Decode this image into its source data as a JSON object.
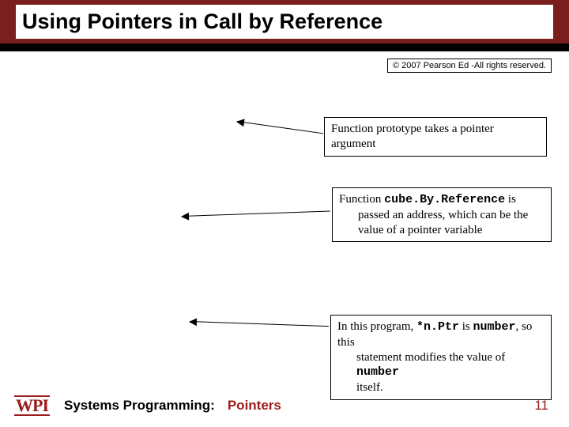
{
  "title": "Using Pointers in Call by Reference",
  "copyright": "© 2007 Pearson Ed -All rights reserved.",
  "callouts": {
    "c1": {
      "text": "Function prototype takes a pointer argument"
    },
    "c2": {
      "line1_pre": "Function ",
      "line1_code": "cube.By.Reference",
      "line1_post": " is",
      "line2": "passed an address, which can be the",
      "line3": "value of a pointer variable"
    },
    "c3": {
      "line1_pre": "In this program, ",
      "line1_code1": "*n.Ptr",
      "line1_mid": " is ",
      "line1_code2": "number",
      "line1_post": ", so this",
      "line2_pre": "statement modifies the value of ",
      "line2_code": "number",
      "line3": "itself."
    }
  },
  "footer": {
    "label": "Systems Programming:",
    "topic": "Pointers",
    "page": "11",
    "logo": "WPI"
  }
}
